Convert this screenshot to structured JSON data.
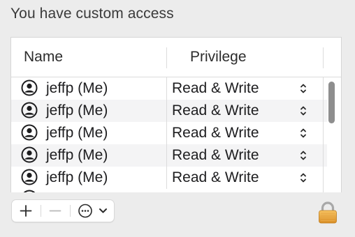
{
  "heading": "You have custom access",
  "table": {
    "columns": {
      "name": "Name",
      "privilege": "Privilege"
    },
    "rows": [
      {
        "name": "jeffp (Me)",
        "privilege": "Read & Write"
      },
      {
        "name": "jeffp (Me)",
        "privilege": "Read & Write"
      },
      {
        "name": "jeffp (Me)",
        "privilege": "Read & Write"
      },
      {
        "name": "jeffp (Me)",
        "privilege": "Read & Write"
      },
      {
        "name": "jeffp (Me)",
        "privilege": "Read & Write"
      }
    ]
  },
  "icons": {
    "user": "person-circle-icon",
    "stepper": "up-down-chevron-icon",
    "add": "plus-icon",
    "remove": "minus-icon",
    "more": "ellipsis-circle-icon",
    "menu": "chevron-down-icon",
    "lock": "lock-icon"
  },
  "colors": {
    "lock": "#e8a640",
    "scroll_thumb": "#8e8e8e"
  }
}
